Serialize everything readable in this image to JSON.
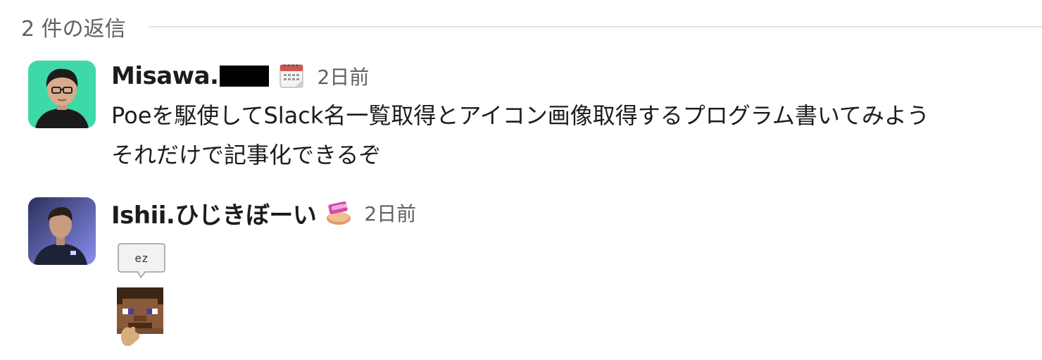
{
  "thread": {
    "reply_count_label": "2 件の返信"
  },
  "messages": [
    {
      "author": "Misawa.",
      "avatar": "avatar-photo",
      "status_emoji": "calendar-icon",
      "timestamp": "2日前",
      "lines": [
        "Poeを駆使してSlack名一覧取得とアイコン画像取得するプログラム書いてみよう",
        "それだけで記事化できるぞ"
      ]
    },
    {
      "author": "Ishii.ひじきぼーい",
      "avatar": "avatar-photo",
      "status_emoji": "sushi-sticker-icon",
      "timestamp": "2日前",
      "custom_emoji": [
        {
          "name": "ez-speech-bubble",
          "text": "ez"
        },
        {
          "name": "minecraft-steve-thinking"
        }
      ]
    }
  ],
  "colors": {
    "text": "#1d1c1d",
    "muted": "#616061",
    "divider": "#e2e2e2",
    "avatar1_bg": "#3fd8a8",
    "avatar2_bg": "#6a6fd6"
  }
}
